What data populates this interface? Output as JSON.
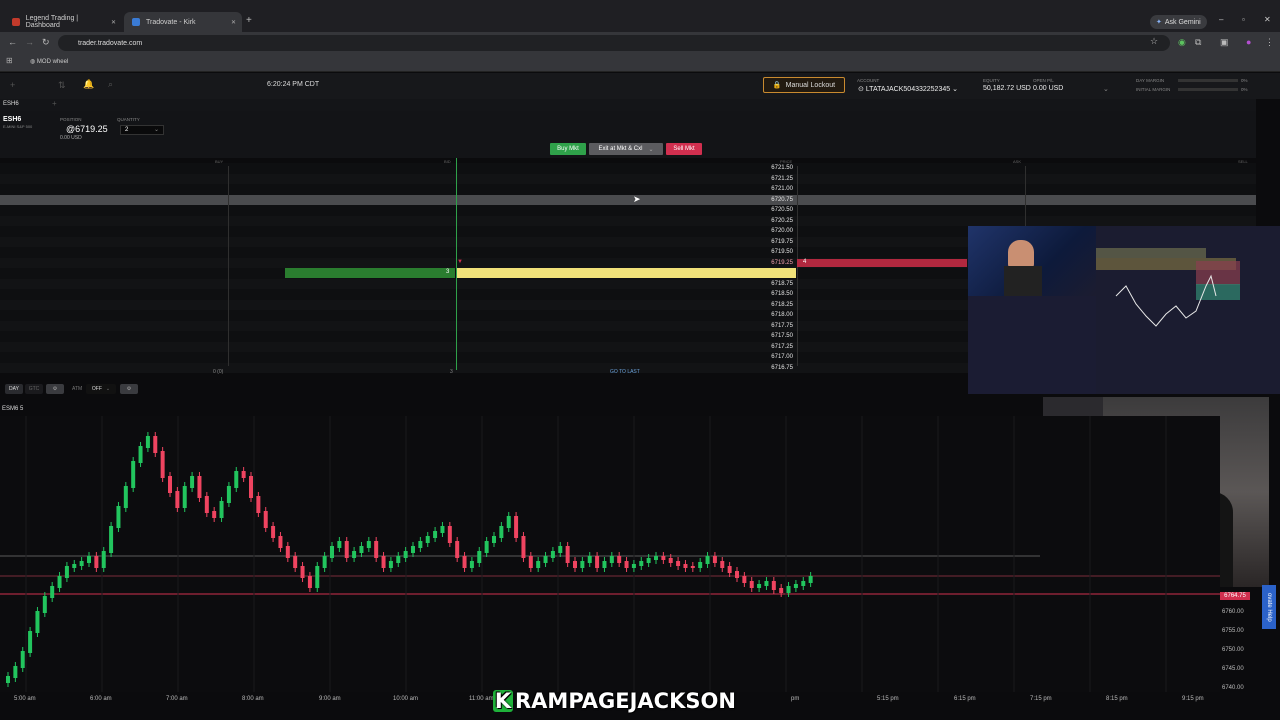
{
  "browser": {
    "tabs": [
      {
        "label": "Legend Trading | Dashboard"
      },
      {
        "label": "Tradovate - Kirk"
      }
    ],
    "url": "trader.tradovate.com",
    "gemini_label": "Ask Gemini",
    "bookmark": "MOD wheel"
  },
  "header": {
    "clock": "6:20:24 PM CDT",
    "lockout_label": "Manual Lockout",
    "account_label": "ACCOUNT",
    "account_value": "LTATAJACK504332252345",
    "equity_label": "EQUITY",
    "equity_value": "50,182.72 USD",
    "open_pl_label": "OPEN P/L",
    "open_pl_value": "0.00 USD",
    "day_margin_label": "DAY MARGIN",
    "initial_margin_label": "INITIAL MARGIN",
    "day_margin_pct": "0%",
    "initial_margin_pct": "0%"
  },
  "dom": {
    "symbol": "ESH6",
    "symbol_desc": "E-MINI S&P 500",
    "position_label": "POSITION",
    "position_value": "@6719.25",
    "position_usd": "0.00 USD",
    "quantity_label": "QUANTITY",
    "quantity_value": "2",
    "buy_mkt": "Buy Mkt",
    "exit_label": "Exit at Mkt & Cxl",
    "sell_mkt": "Sell Mkt",
    "col_buy": "BUY",
    "col_bid": "BID",
    "col_price": "PRICE",
    "col_ask": "ASK",
    "col_sell": "SELL",
    "prices": [
      "6721.50",
      "6721.25",
      "6721.00",
      "6720.75",
      "6720.50",
      "6720.25",
      "6720.00",
      "6719.75",
      "6719.50",
      "6719.25",
      "6719.00",
      "6718.75",
      "6718.50",
      "6718.25",
      "6718.00",
      "6717.75",
      "6717.50",
      "6717.25",
      "6717.00",
      "6716.75"
    ],
    "bid_size": "3",
    "ask_size": "4",
    "foot_left": "0 (0)",
    "foot_mid": "3",
    "go_to_last": "GO TO LAST",
    "tif_day": "DAY",
    "tif_gtc": "GTC",
    "atm_label": "ATM",
    "atm_value": "OFF"
  },
  "chart": {
    "symbol": "ESM6 5",
    "last_price": "6764.75",
    "y_ticks": [
      "6760.00",
      "6755.00",
      "6750.00",
      "6745.00",
      "6740.00"
    ],
    "x_ticks": [
      "5:00 am",
      "6:00 am",
      "7:00 am",
      "8:00 am",
      "9:00 am",
      "10:00 am",
      "11:00 am",
      "pm",
      "5:15 pm",
      "6:15 pm",
      "7:15 pm",
      "8:15 pm",
      "9:15 pm"
    ],
    "watermark": "RAMPAGEJACKSON",
    "watermark_k": "K",
    "help_label": "ovate Help"
  },
  "colors": {
    "buy": "#2fa14a",
    "sell": "#d12f4f",
    "accent": "#c98a2f"
  }
}
